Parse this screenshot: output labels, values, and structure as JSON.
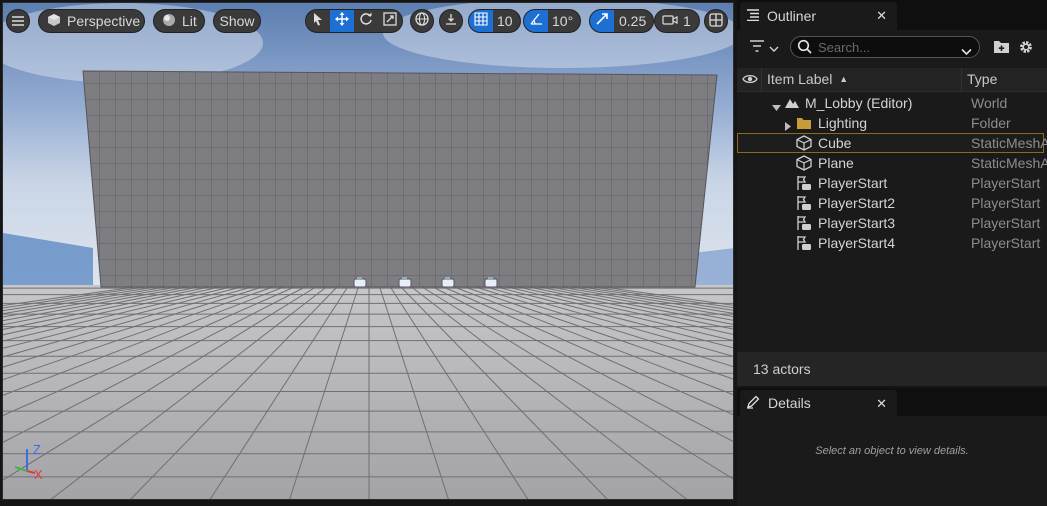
{
  "viewport": {
    "menu_icon": "hamburger-icon",
    "view_mode": "Perspective",
    "lighting": "Lit",
    "show": "Show",
    "grid_snap": "10",
    "rotation_snap": "10°",
    "scale_snap": "0.25",
    "camera_speed": "1",
    "axis": {
      "z": "Z",
      "x": "X"
    }
  },
  "outliner": {
    "tab_title": "Outliner",
    "search_placeholder": "Search...",
    "columns": {
      "label": "Item Label",
      "type": "Type"
    },
    "items": [
      {
        "label": "M_Lobby (Editor)",
        "type": "World",
        "icon": "world-icon"
      },
      {
        "label": "Lighting",
        "type": "Folder",
        "icon": "folder-icon"
      },
      {
        "label": "Cube",
        "type": "StaticMeshA",
        "icon": "static-mesh-icon"
      },
      {
        "label": "Plane",
        "type": "StaticMeshA",
        "icon": "static-mesh-icon"
      },
      {
        "label": "PlayerStart",
        "type": "PlayerStart",
        "icon": "player-start-icon"
      },
      {
        "label": "PlayerStart2",
        "type": "PlayerStart",
        "icon": "player-start-icon"
      },
      {
        "label": "PlayerStart3",
        "type": "PlayerStart",
        "icon": "player-start-icon"
      },
      {
        "label": "PlayerStart4",
        "type": "PlayerStart",
        "icon": "player-start-icon"
      }
    ],
    "actor_count": "13 actors"
  },
  "details": {
    "tab_title": "Details",
    "empty_text": "Select an object to view details."
  },
  "colors": {
    "accent_blue": "#1d6fd4",
    "selection_border": "#8a6a1f",
    "folder": "#c79a3a"
  }
}
